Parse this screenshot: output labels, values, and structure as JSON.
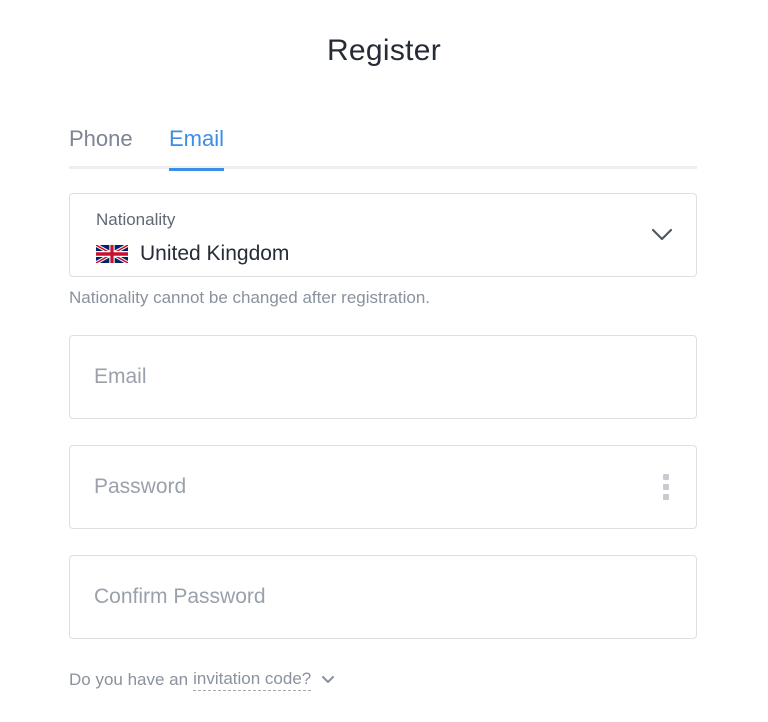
{
  "header": {
    "title": "Register"
  },
  "tabs": [
    {
      "label": "Phone",
      "active": false
    },
    {
      "label": "Email",
      "active": true
    }
  ],
  "nationality": {
    "label": "Nationality",
    "value": "United Kingdom",
    "flag_icon": "uk-flag-icon",
    "dropdown_icon": "chevron-down-icon",
    "hint": "Nationality cannot be changed after registration."
  },
  "form": {
    "email": {
      "value": "",
      "placeholder": "Email"
    },
    "password": {
      "value": "",
      "placeholder": "Password",
      "options_icon": "vertical-dots-icon"
    },
    "confirm_password": {
      "value": "",
      "placeholder": "Confirm Password"
    }
  },
  "invitation": {
    "prefix": "Do you have an",
    "link_text": "invitation code?",
    "toggle_icon": "chevron-down-icon"
  },
  "colors": {
    "accent": "#3a8ee6",
    "text": "#262c36",
    "muted": "#8a929d",
    "border": "#dcdfe4"
  }
}
